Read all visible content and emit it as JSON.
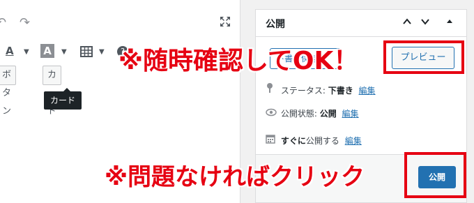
{
  "editor": {
    "undo_glyph": "↶",
    "redo_glyph": "↷",
    "toolbar": {
      "text_color_label": "A",
      "bg_color_label": "A",
      "dropdown_glyph": "▼",
      "help_glyph": "?"
    },
    "quicktags": [
      "ボタン",
      "カード"
    ],
    "tooltip": "カード"
  },
  "publish_panel": {
    "title": "公開",
    "controls": [
      "⌃",
      "⌄",
      "▴"
    ],
    "save_draft_label": "下書き保存",
    "preview_label": "プレビュー",
    "status": {
      "label": "ステータス:",
      "value": "下書き",
      "edit": "編集"
    },
    "visibility": {
      "label": "公開状態:",
      "value": "公開",
      "edit": "編集"
    },
    "schedule": {
      "label": "すぐに",
      "value": "公開する",
      "edit": "編集"
    },
    "publish_label": "公開"
  },
  "annotations": {
    "top": "※随時確認してOK！",
    "bottom": "※問題なければクリック",
    "color": "#e60012"
  }
}
